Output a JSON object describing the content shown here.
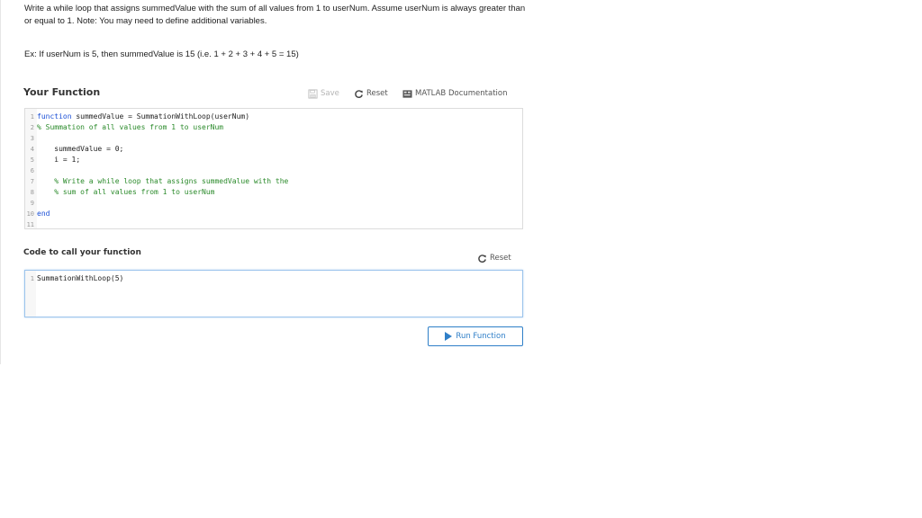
{
  "problem": {
    "statement": "Write a while loop that assigns summedValue with the sum of all values from 1 to userNum. Assume userNum is always greater than or equal to 1. Note: You may need to define additional variables.",
    "example": "Ex: If userNum is 5, then summedValue is 15 (i.e. 1 + 2 + 3 + 4 + 5 = 15)"
  },
  "your_function": {
    "title": "Your Function",
    "toolbar": {
      "save_label": "Save",
      "reset_label": "Reset",
      "docs_label": "MATLAB Documentation"
    },
    "code": [
      {
        "n": "1",
        "parts": [
          {
            "t": "function ",
            "c": "kw"
          },
          {
            "t": "summedValue = SummationWithLoop(userNum)",
            "c": "tx"
          }
        ]
      },
      {
        "n": "2",
        "parts": [
          {
            "t": "% Summation of all values from 1 to userNum",
            "c": "cm"
          }
        ]
      },
      {
        "n": "3",
        "parts": []
      },
      {
        "n": "4",
        "parts": [
          {
            "t": "    summedValue = 0;",
            "c": "tx"
          }
        ]
      },
      {
        "n": "5",
        "parts": [
          {
            "t": "    i = 1;",
            "c": "tx"
          }
        ]
      },
      {
        "n": "6",
        "parts": []
      },
      {
        "n": "7",
        "parts": [
          {
            "t": "    % Write a while loop that assigns summedValue with the",
            "c": "cm"
          }
        ]
      },
      {
        "n": "8",
        "parts": [
          {
            "t": "    % sum of all values from 1 to userNum",
            "c": "cm"
          }
        ]
      },
      {
        "n": "9",
        "parts": []
      },
      {
        "n": "10",
        "parts": [
          {
            "t": "end",
            "c": "kw"
          }
        ]
      },
      {
        "n": "11",
        "parts": []
      }
    ]
  },
  "call_function": {
    "title": "Code to call your function",
    "reset_label": "Reset",
    "code": [
      {
        "n": "1",
        "parts": [
          {
            "t": "SummationWithLoop(5)",
            "c": "tx"
          }
        ]
      }
    ]
  },
  "run_button": {
    "label": "Run Function"
  },
  "icons": {
    "save": "save-icon",
    "reset": "reset-icon",
    "docs": "matlab-docs-icon",
    "run": "play-icon"
  },
  "colors": {
    "accent": "#2f7fc8",
    "keyword": "#1a4fd6",
    "comment": "#2a8a2a",
    "disabled": "#b5b5b5"
  }
}
